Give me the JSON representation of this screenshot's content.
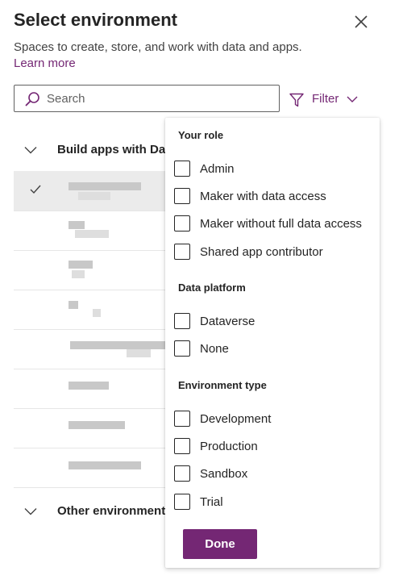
{
  "header": {
    "title": "Select environment",
    "subtitle": "Spaces to create, store, and work with data and apps.",
    "learn_more": "Learn more"
  },
  "search": {
    "placeholder": "Search",
    "value": ""
  },
  "filter": {
    "label": "Filter"
  },
  "groups": [
    {
      "label": "Build apps with Da"
    },
    {
      "label": "Other environment"
    }
  ],
  "environments": [
    {
      "selected": true
    },
    {
      "selected": false
    },
    {
      "selected": false
    },
    {
      "selected": false
    },
    {
      "selected": false
    },
    {
      "selected": false
    },
    {
      "selected": false
    },
    {
      "selected": false
    }
  ],
  "filter_panel": {
    "role_title": "Your role",
    "roles": [
      "Admin",
      "Maker with data access",
      "Maker without full data access",
      "Shared app contributor"
    ],
    "platform_title": "Data platform",
    "platforms": [
      "Dataverse",
      "None"
    ],
    "type_title": "Environment type",
    "types": [
      "Development",
      "Production",
      "Sandbox",
      "Trial"
    ],
    "done_label": "Done"
  },
  "colors": {
    "accent": "#742774",
    "selected_row": "#ebebeb"
  }
}
